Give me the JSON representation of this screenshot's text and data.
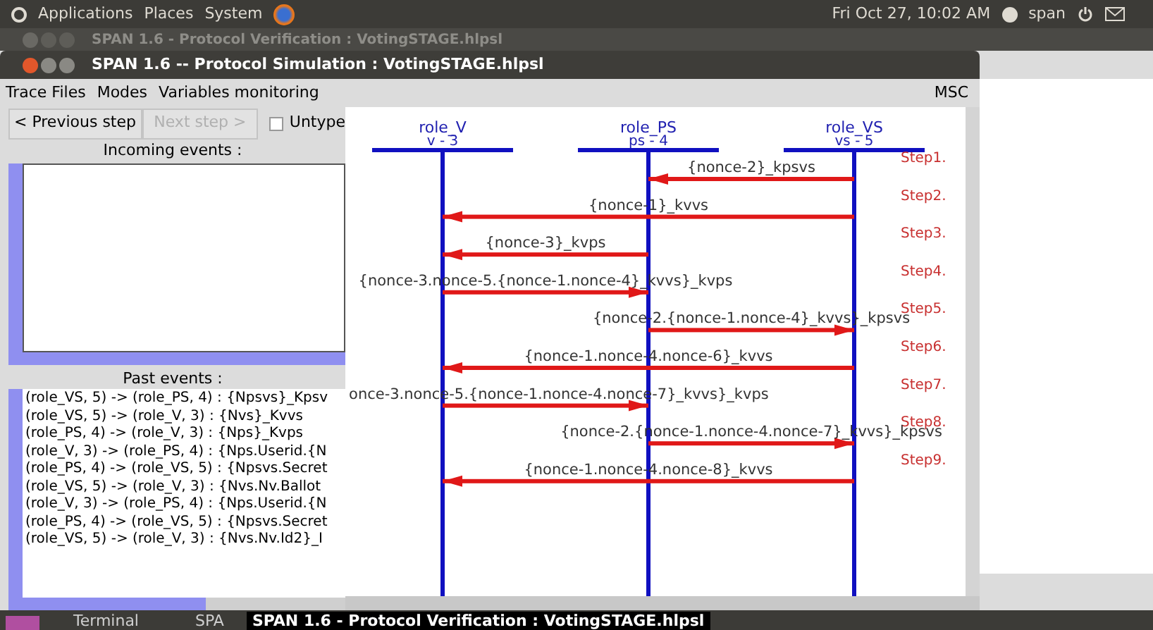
{
  "top_panel": {
    "menus": [
      "Applications",
      "Places",
      "System"
    ],
    "clock": "Fri Oct 27, 10:02 AM",
    "user": "span"
  },
  "background_window": {
    "title": "SPAN 1.6 - Protocol Verification : VotingSTAGE.hlpsl"
  },
  "window": {
    "title": "SPAN 1.6 -- Protocol Simulation : VotingSTAGE.hlpsl"
  },
  "menu": [
    "Trace Files",
    "Modes",
    "Variables monitoring"
  ],
  "menu_right": "MSC",
  "controls": [
    {
      "kind": "button",
      "label": "< Previous step",
      "disabled": false
    },
    {
      "kind": "button",
      "label": "Next step >",
      "disabled": true
    },
    {
      "kind": "checkbox",
      "label": "Untype",
      "checked": false
    }
  ],
  "incoming_events": {
    "label": "Incoming events :"
  },
  "past_events": {
    "label": "Past events :",
    "items": [
      "(role_VS, 5) -> (role_PS, 4) : {Npsvs}_Kpsv",
      "(role_VS, 5) -> (role_V, 3) : {Nvs}_Kvvs",
      "(role_PS, 4) -> (role_V, 3) : {Nps}_Kvps",
      "(role_V, 3) -> (role_PS, 4) : {Nps.Userid.{N",
      "(role_PS, 4) -> (role_VS, 5) : {Npsvs.Secret",
      "(role_VS, 5) -> (role_V, 3) : {Nvs.Nv.Ballot",
      "(role_V, 3) -> (role_PS, 4) : {Nps.Userid.{N",
      "(role_PS, 4) -> (role_VS, 5) : {Npsvs.Secret",
      "(role_VS, 5) -> (role_V, 3) : {Nvs.Nv.Id2}_I"
    ]
  },
  "msc": {
    "lifelines": [
      {
        "name": "role_V",
        "sub": "v - 3"
      },
      {
        "name": "role_PS",
        "sub": "ps - 4"
      },
      {
        "name": "role_VS",
        "sub": "vs - 5"
      }
    ],
    "messages": [
      {
        "step": "Step1.",
        "text": "{nonce-2}_kpsvs"
      },
      {
        "step": "Step2.",
        "text": "{nonce-1}_kvvs"
      },
      {
        "step": "Step3.",
        "text": "{nonce-3}_kvps"
      },
      {
        "step": "Step4.",
        "text": "{nonce-3.nonce-5.{nonce-1.nonce-4}_kvvs}_kvps"
      },
      {
        "step": "Step5.",
        "text": "{nonce-2.{nonce-1.nonce-4}_kvvs}_kpsvs"
      },
      {
        "step": "Step6.",
        "text": "{nonce-1.nonce-4.nonce-6}_kvvs"
      },
      {
        "step": "Step7.",
        "text": "once-3.nonce-5.{nonce-1.nonce-4.nonce-7}_kvvs}_kvps"
      },
      {
        "step": "Step8.",
        "text": "{nonce-2.{nonce-1.nonce-4.nonce-7}_kvvs}_kpsvs"
      },
      {
        "step": "Step9.",
        "text": "{nonce-1.nonce-4.nonce-8}_kvvs"
      }
    ]
  },
  "taskbar": {
    "items": [
      "Terminal",
      "SPA"
    ],
    "tooltip": "SPAN 1.6 - Protocol Verification : VotingSTAGE.hlpsl"
  }
}
